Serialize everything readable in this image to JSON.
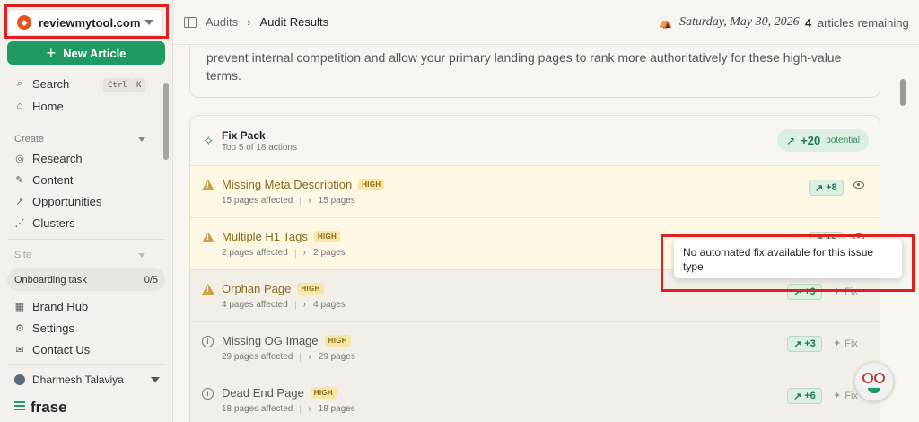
{
  "workspace": {
    "name": "reviewmytool.com"
  },
  "sidebar": {
    "new_article": "New Article",
    "search": {
      "label": "Search",
      "shortcut_mod": "Ctrl",
      "shortcut_key": "K"
    },
    "home": "Home",
    "create_section": "Create",
    "create_items": [
      "Research",
      "Content",
      "Opportunities",
      "Clusters"
    ],
    "site_section": "Site",
    "onboarding": {
      "label": "Onboarding task",
      "progress": "0/5"
    },
    "site_items": [
      "Brand Hub",
      "Settings",
      "Contact Us"
    ],
    "user": "Dharmesh Talaviya",
    "brand": "frase"
  },
  "topbar": {
    "crumb_parent": "Audits",
    "crumb_current": "Audit Results",
    "date": "Saturday, May 30, 2026",
    "remaining_count": "4",
    "remaining_label": "articles remaining"
  },
  "intro": {
    "text": "prevent internal competition and allow your primary landing pages to rank more authoritatively for these high-value terms."
  },
  "fix_pack": {
    "title": "Fix Pack",
    "subtitle": "Top 5 of 18 actions",
    "potential_value": "+20",
    "potential_label": "potential",
    "rows": [
      {
        "title": "Missing Meta Description",
        "severity": "HIGH",
        "affected": "15 pages affected",
        "pages": "15 pages",
        "gain": "+8",
        "kind": "warn"
      },
      {
        "title": "Multiple H1 Tags",
        "severity": "HIGH",
        "affected": "2 pages affected",
        "pages": "2 pages",
        "gain": "+6",
        "kind": "warn"
      },
      {
        "title": "Orphan Page",
        "severity": "HIGH",
        "affected": "4 pages affected",
        "pages": "4 pages",
        "gain": "+9",
        "kind": "warn",
        "fix": "Fix"
      },
      {
        "title": "Missing OG Image",
        "severity": "HIGH",
        "affected": "29 pages affected",
        "pages": "29 pages",
        "gain": "+3",
        "kind": "info",
        "fix": "Fix"
      },
      {
        "title": "Dead End Page",
        "severity": "HIGH",
        "affected": "18 pages affected",
        "pages": "18 pages",
        "gain": "+6",
        "kind": "info",
        "fix": "Fix"
      }
    ]
  },
  "tooltip": {
    "text": "No automated fix available for this issue type"
  },
  "icons": {
    "accent": "#1f9a63",
    "warning": "#c9a24a",
    "highlight": "#e02020"
  }
}
